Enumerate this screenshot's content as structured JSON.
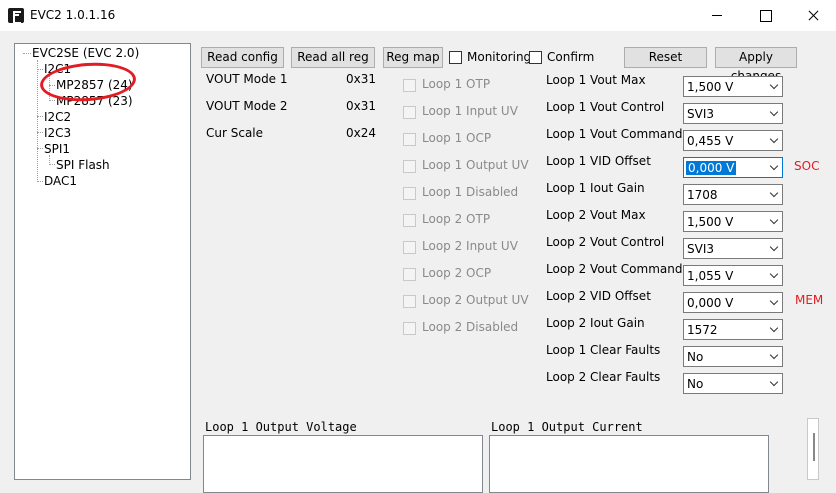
{
  "window": {
    "title": "EVC2 1.0.1.16"
  },
  "tree": {
    "root": "EVC2SE (EVC 2.0)",
    "i2c1": "I2C1",
    "mp1": "MP2857 (24)",
    "mp2": "MP2857 (23)",
    "i2c2": "I2C2",
    "i2c3": "I2C3",
    "spi1": "SPI1",
    "spiflash": "SPI Flash",
    "dac1": "DAC1"
  },
  "toolbar": {
    "read_config": "Read config",
    "read_all_reg": "Read all reg",
    "reg_map": "Reg map",
    "monitoring": "Monitoring",
    "confirm": "Confirm",
    "reset": "Reset",
    "apply_changes": "Apply changes"
  },
  "info": [
    {
      "label": "VOUT Mode 1",
      "value": "0x31"
    },
    {
      "label": "VOUT Mode 2",
      "value": "0x31"
    },
    {
      "label": "Cur Scale",
      "value": "0x24"
    }
  ],
  "flags": [
    "Loop 1 OTP",
    "Loop 1 Input UV",
    "Loop 1 OCP",
    "Loop 1 Output UV",
    "Loop 1 Disabled",
    "Loop 2 OTP",
    "Loop 2 Input UV",
    "Loop 2 OCP",
    "Loop 2 Output UV",
    "Loop 2 Disabled"
  ],
  "settings": [
    {
      "label": "Loop 1 Vout Max",
      "value": "1,500 V"
    },
    {
      "label": "Loop 1 Vout Control",
      "value": "SVI3"
    },
    {
      "label": "Loop 1 Vout Command",
      "value": "0,455 V"
    },
    {
      "label": "Loop 1 VID Offset",
      "value": "0,000 V"
    },
    {
      "label": "Loop 1 Iout Gain",
      "value": "1708"
    },
    {
      "label": "Loop 2 Vout Max",
      "value": "1,500 V"
    },
    {
      "label": "Loop 2 Vout Control",
      "value": "SVI3"
    },
    {
      "label": "Loop 2 Vout Command",
      "value": "1,055 V"
    },
    {
      "label": "Loop 2 VID Offset",
      "value": "0,000 V"
    },
    {
      "label": "Loop 2 Iout Gain",
      "value": "1572"
    },
    {
      "label": "Loop 1 Clear Faults",
      "value": "No"
    },
    {
      "label": "Loop 2 Clear Faults",
      "value": "No"
    }
  ],
  "annotations": {
    "soc": "SOC",
    "mem": "MEM",
    "color": "#e31b23"
  },
  "graphs": {
    "voltage_title": "Loop 1 Output Voltage",
    "current_title": "Loop 1 Output Current"
  }
}
